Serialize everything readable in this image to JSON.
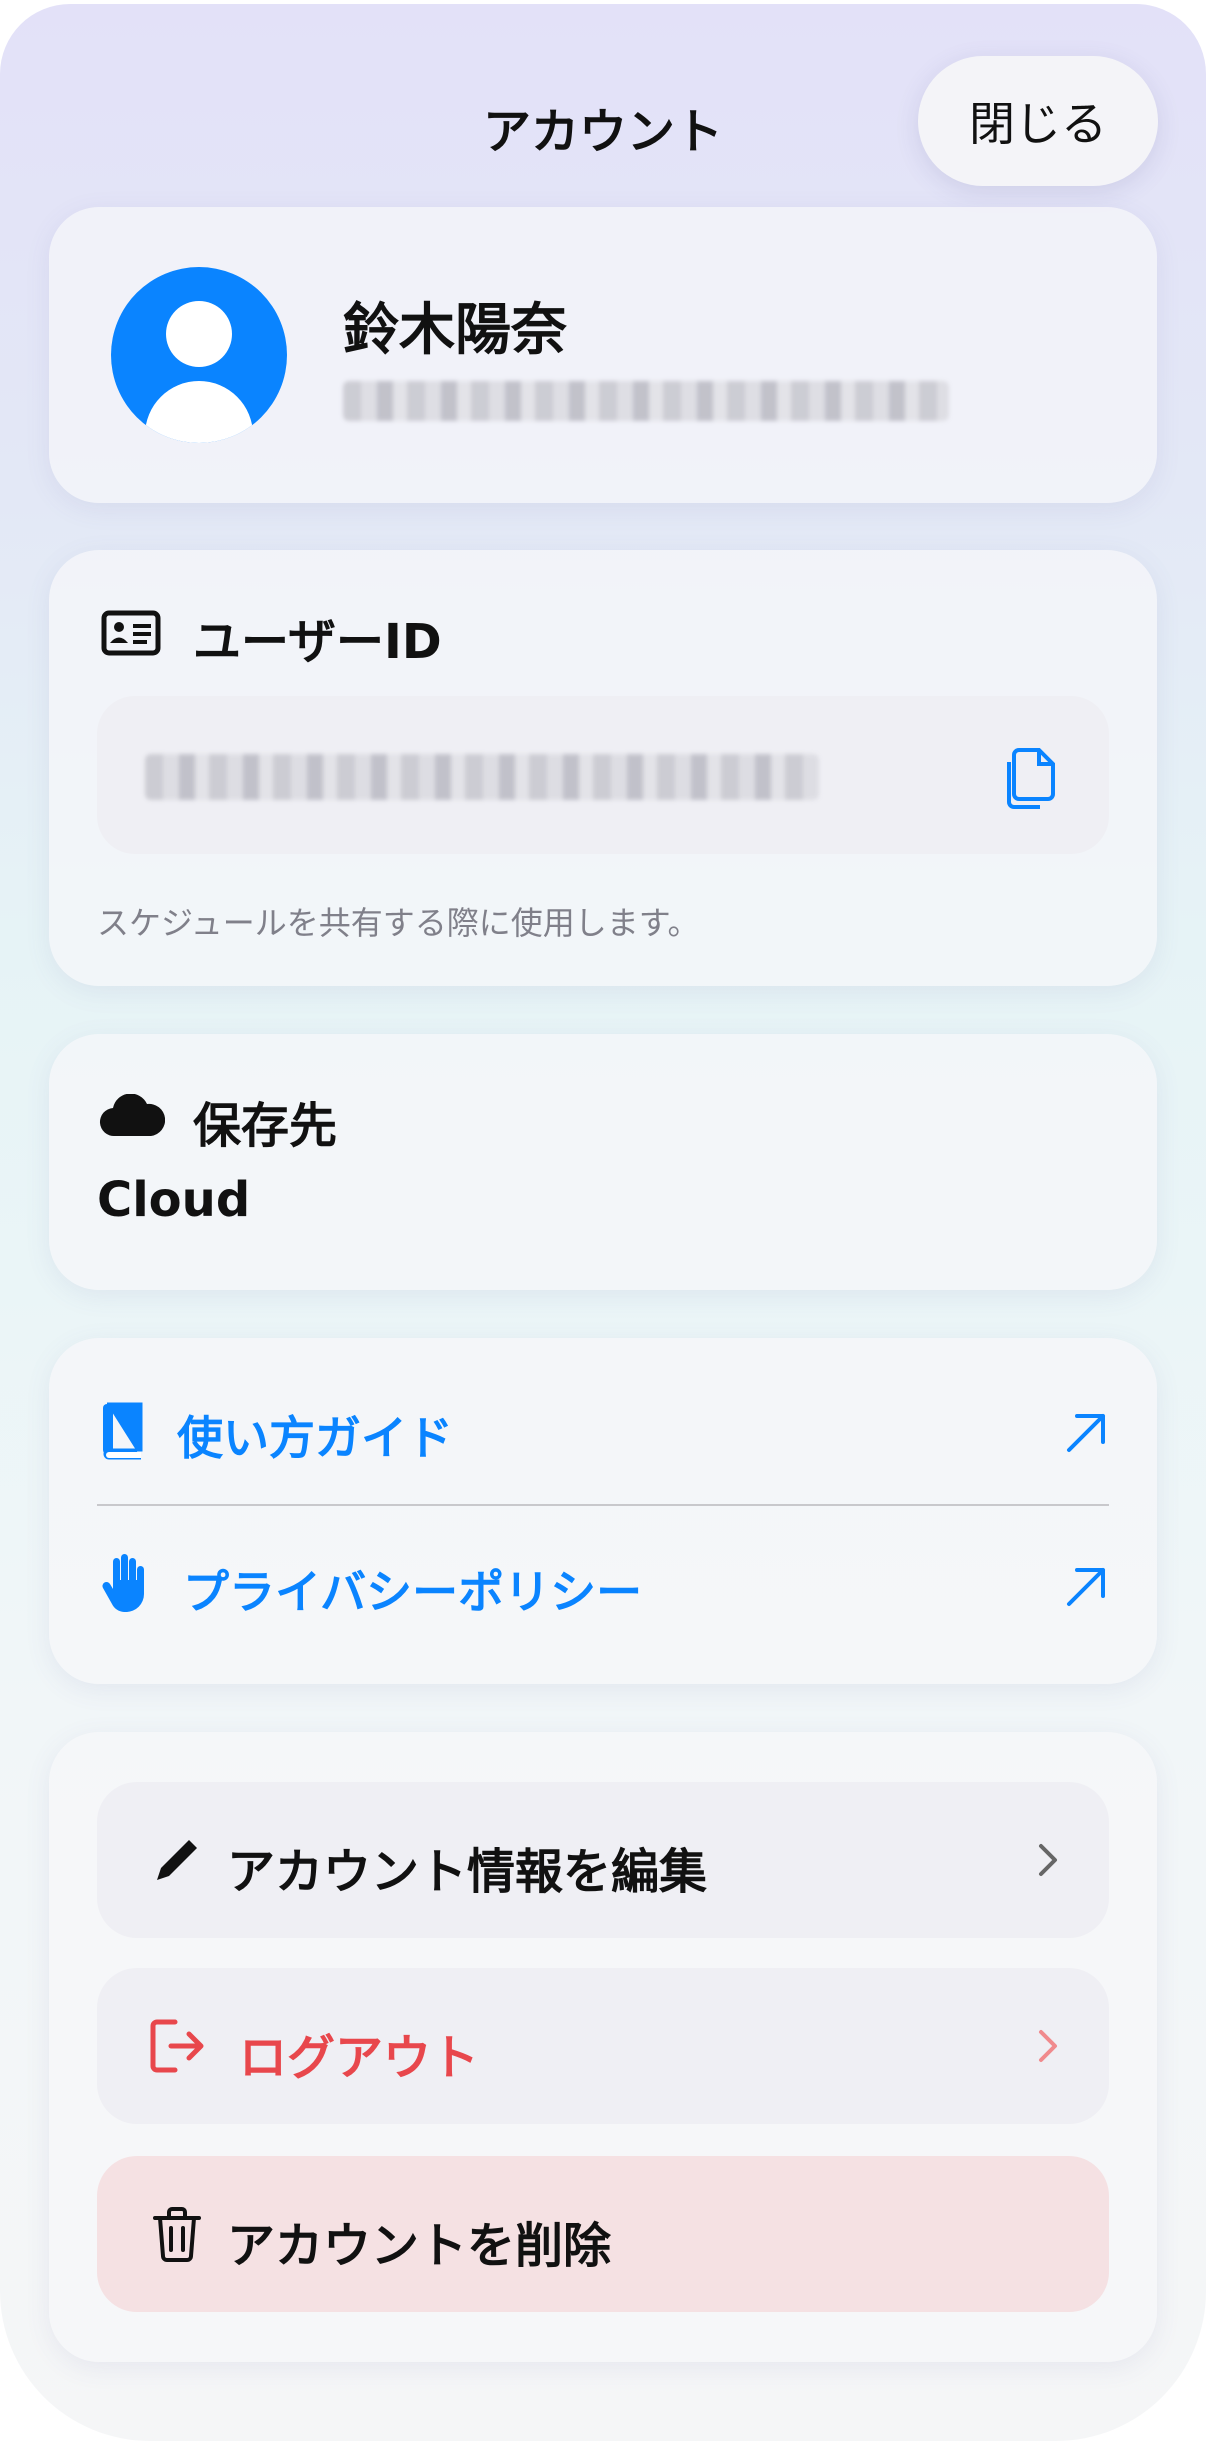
{
  "header": {
    "title": "アカウント",
    "close_label": "閉じる"
  },
  "profile": {
    "name": "鈴木陽奈"
  },
  "user_id": {
    "title": "ユーザーID",
    "hint": "スケジュールを共有する際に使用します。"
  },
  "storage": {
    "title": "保存先",
    "value": "Cloud"
  },
  "links": [
    {
      "label": "使い方ガイド",
      "icon": "book-icon"
    },
    {
      "label": "プライバシーポリシー",
      "icon": "hand-icon"
    }
  ],
  "actions": {
    "edit": "アカウント情報を編集",
    "logout": "ログアウト",
    "delete": "アカウントを削除"
  },
  "colors": {
    "accent": "#0a84ff",
    "danger": "#e8474c",
    "delete_bg": "#f5e1e3"
  }
}
